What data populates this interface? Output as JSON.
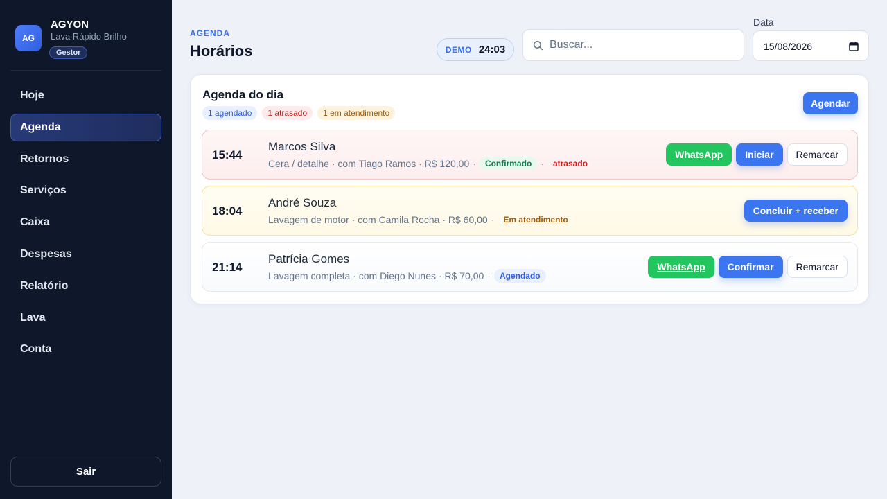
{
  "brand": {
    "initials": "AG",
    "name": "AGYON",
    "business": "Lava Rápido Brilho",
    "role": "Gestor"
  },
  "nav": {
    "items": [
      {
        "label": "Hoje"
      },
      {
        "label": "Agenda"
      },
      {
        "label": "Retornos"
      },
      {
        "label": "Serviços"
      },
      {
        "label": "Caixa"
      },
      {
        "label": "Despesas"
      },
      {
        "label": "Relatório"
      },
      {
        "label": "Lava"
      },
      {
        "label": "Conta"
      }
    ],
    "active": "Agenda",
    "logout_label": "Sair"
  },
  "header": {
    "eyebrow": "AGENDA",
    "title": "Horários",
    "demo_label": "DEMO",
    "demo_time": "24:03",
    "search_placeholder": "Buscar...",
    "date_label": "Data",
    "date_value": "15/08/2026"
  },
  "agenda": {
    "title": "Agenda do dia",
    "summary": {
      "scheduled": "1 agendado",
      "late": "1 atrasado",
      "serving": "1 em atendimento"
    },
    "schedule_button": "Agendar",
    "appointments": [
      {
        "time": "15:44",
        "client": "Marcos Silva",
        "details": "Cera / detalhe · com Tiago Ramos · R$ 120,00",
        "status": "Confirmado",
        "flag": "atrasado",
        "actions": [
          "WhatsApp",
          "Iniciar",
          "Remarcar"
        ]
      },
      {
        "time": "18:04",
        "client": "André Souza",
        "details": "Lavagem de motor · com Camila Rocha · R$ 60,00",
        "status": "Em atendimento",
        "actions": [
          "Concluir + receber"
        ]
      },
      {
        "time": "21:14",
        "client": "Patrícia Gomes",
        "details": "Lavagem completa · com Diego Nunes · R$ 70,00",
        "status": "Agendado",
        "actions": [
          "WhatsApp",
          "Confirmar",
          "Remarcar"
        ]
      }
    ]
  },
  "colors": {
    "sidebar_bg": "#0f172a",
    "accent": "#3b76f0",
    "whatsapp": "#22c55e",
    "late": "#c81e1e",
    "serving": "#a35b06"
  },
  "icons": {
    "search": "search-icon",
    "calendar": "calendar-icon"
  }
}
